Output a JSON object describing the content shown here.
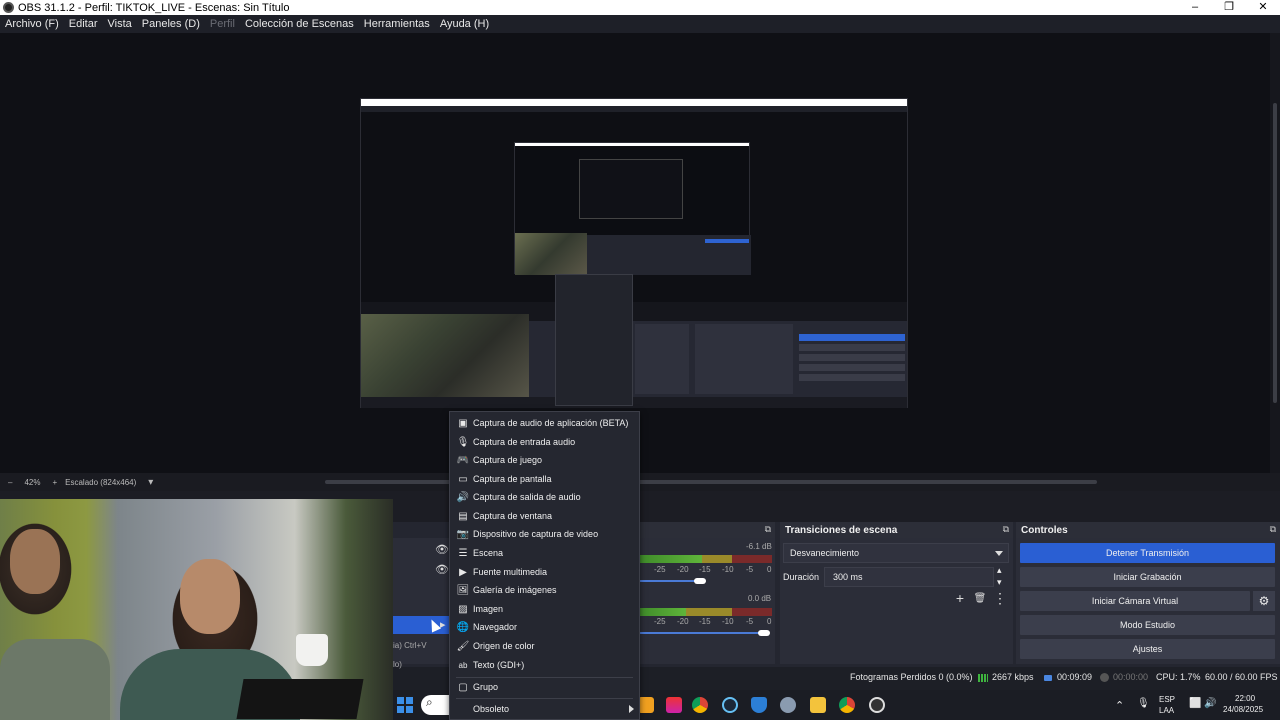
{
  "window": {
    "title": "OBS 31.1.2 - Perfil: TIKTOK_LIVE - Escenas: Sin Título",
    "controls": [
      "–",
      "❐",
      "✕"
    ]
  },
  "menubar": {
    "items": [
      {
        "label": "Archivo (F)",
        "enabled": true
      },
      {
        "label": "Editar",
        "enabled": true
      },
      {
        "label": "Vista",
        "enabled": true
      },
      {
        "label": "Paneles (D)",
        "enabled": true
      },
      {
        "label": "Perfil",
        "enabled": false
      },
      {
        "label": "Colección de Escenas",
        "enabled": true
      },
      {
        "label": "Herramientas",
        "enabled": true
      },
      {
        "label": "Ayuda (H)",
        "enabled": true
      }
    ]
  },
  "preview_status": {
    "zoom_minus": "–",
    "zoom": "42%",
    "zoom_plus": "+",
    "scale_mode": "Escalado (824x464)",
    "dropdown_glyph": "▾"
  },
  "panels": {
    "transitions": {
      "title": "Transiciones de escena",
      "transition": "Desvanecimiento",
      "duration_label": "Duración",
      "duration": "300 ms",
      "undock_glyph": "⧉",
      "add_glyph": "+",
      "delete_glyph": "🗑",
      "more_glyph": "⋮",
      "spin_up": "▴",
      "spin_down": "▾"
    },
    "controls": {
      "title": "Controles",
      "undock_glyph": "⧉",
      "buttons": {
        "stop_stream": "Detener Transmisión",
        "start_recording": "Iniciar Grabación",
        "start_virtual_cam": "Iniciar Cámara Virtual",
        "studio_mode": "Modo Estudio",
        "settings": "Ajustes"
      },
      "gear_glyph": "⚙"
    },
    "mixer": {
      "undock_glyph": "⧉",
      "channels": [
        {
          "db": "-6.1 dB",
          "ticks": [
            "-25",
            "-20",
            "-15",
            "-10",
            "-5",
            "0"
          ],
          "volume": 0.92
        },
        {
          "db": "0.0 dB",
          "ticks": [
            "-25",
            "-20",
            "-15",
            "-10",
            "-5",
            "0"
          ],
          "volume": 0.97
        }
      ]
    },
    "sources": {
      "fragment_shortcut": "ia)   Ctrl+V",
      "fragment_other": "lo)",
      "eye_glyph": "👁",
      "expand_glyph": "▸"
    }
  },
  "context_menu": {
    "items": [
      {
        "label": "Captura de audio de aplicación (BETA)",
        "icon": "app-audio-icon",
        "glyph": "▣"
      },
      {
        "label": "Captura de entrada audio",
        "icon": "microphone-icon",
        "glyph": "🎙"
      },
      {
        "label": "Captura de juego",
        "icon": "gamepad-icon",
        "glyph": "🎮"
      },
      {
        "label": "Captura de pantalla",
        "icon": "monitor-icon",
        "glyph": "▭"
      },
      {
        "label": "Captura de salida de audio",
        "icon": "speaker-icon",
        "glyph": "🔊"
      },
      {
        "label": "Captura de ventana",
        "icon": "window-icon",
        "glyph": "▤"
      },
      {
        "label": "Dispositivo de captura de video",
        "icon": "camera-icon",
        "glyph": "📷"
      },
      {
        "label": "Escena",
        "icon": "list-icon",
        "glyph": "☰"
      },
      {
        "label": "Fuente multimedia",
        "icon": "play-icon",
        "glyph": "▶"
      },
      {
        "label": "Galería de imágenes",
        "icon": "gallery-icon",
        "glyph": "🖼"
      },
      {
        "label": "Imagen",
        "icon": "image-icon",
        "glyph": "▨"
      },
      {
        "label": "Navegador",
        "icon": "globe-icon",
        "glyph": "🌐"
      },
      {
        "label": "Origen de color",
        "icon": "brush-icon",
        "glyph": "🖌"
      },
      {
        "label": "Texto (GDI+)",
        "icon": "text-icon",
        "glyph": "ab"
      }
    ],
    "group": {
      "label": "Grupo",
      "icon": "group-icon",
      "glyph": "▢"
    },
    "obsolete": {
      "label": "Obsoleto"
    }
  },
  "stats": {
    "dropped_frames": "Fotogramas Perdidos 0 (0.0%)",
    "bitrate": "2667 kbps",
    "stream_time": "00:09:09",
    "rec_time": "00:00:00",
    "cpu": "CPU: 1.7%",
    "fps": "60.00 / 60.00 FPS"
  },
  "taskbar": {
    "search_glyph": "⌕",
    "tray_caret": "⌃",
    "mic_glyph": "🎙",
    "lang_top": "ESP",
    "lang_bottom": "LAA",
    "network_glyph": "⬜",
    "volume_glyph": "🔊",
    "time": "22:00",
    "date": "24/08/2025"
  },
  "colors": {
    "accent": "#2a5fd3",
    "background": "#1d1f26",
    "panel": "#2b2d38"
  }
}
